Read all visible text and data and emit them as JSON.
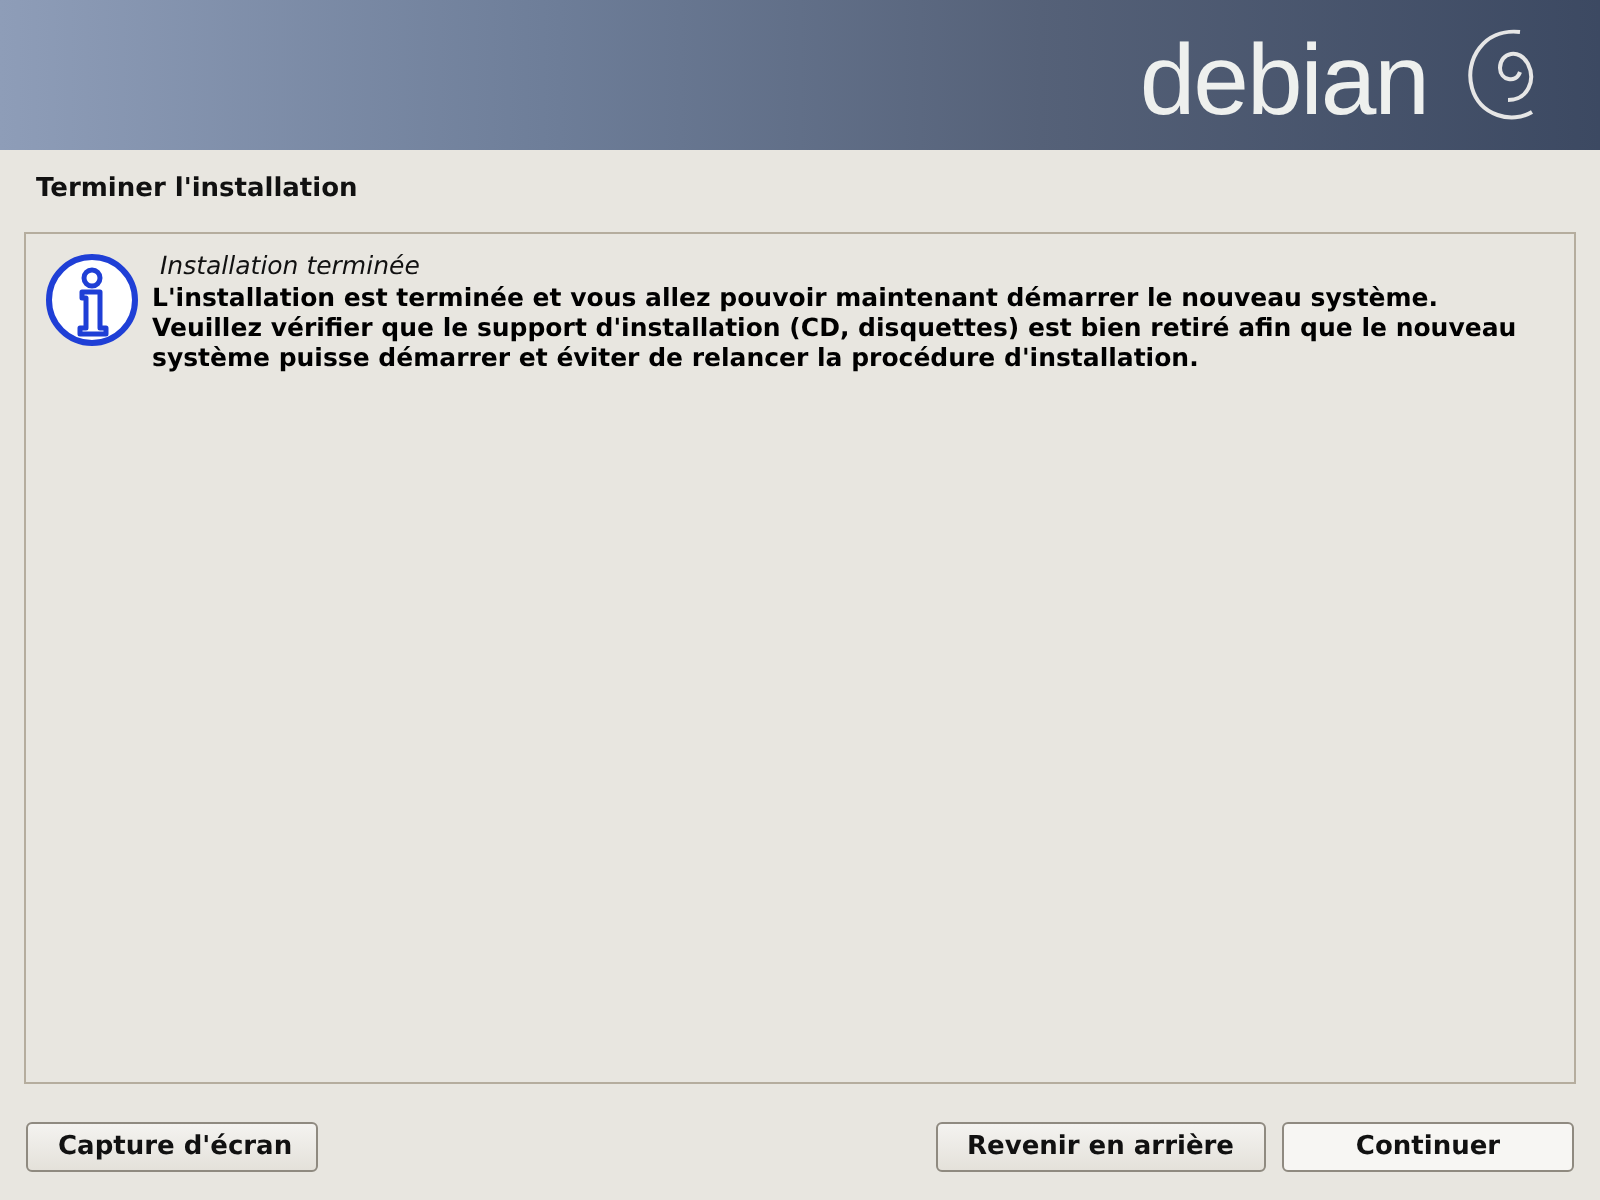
{
  "header": {
    "logo": "debian"
  },
  "step_title": "Terminer l'installation",
  "message": {
    "title": "Installation terminée",
    "text": "L'installation est terminée et vous allez pouvoir maintenant démarrer le nouveau système.\nVeuillez vérifier que le support d'installation (CD, disquettes) est bien retiré afin que le nouveau\nsystème puisse démarrer et éviter de relancer la procédure d'installation."
  },
  "buttons": [
    {
      "label": "Capture d'écran",
      "focused": false
    },
    {
      "label": "Revenir en arrière",
      "focused": false
    },
    {
      "label": "Continuer",
      "focused": true
    }
  ]
}
